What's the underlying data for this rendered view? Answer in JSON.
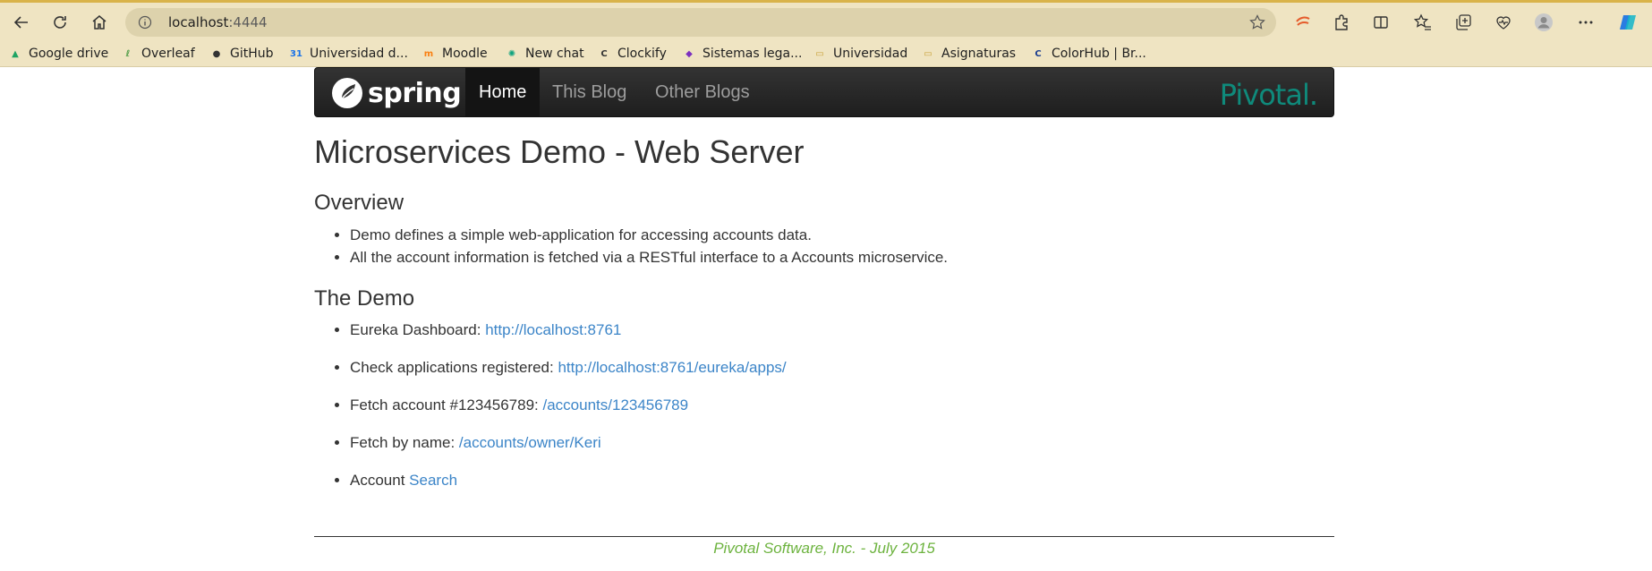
{
  "browser": {
    "url_host": "localhost",
    "url_port": ":4444",
    "icons": [
      "back-icon",
      "refresh-icon",
      "home-icon",
      "site-info-icon",
      "favorite-star-icon",
      "translate-icon",
      "extensions-icon",
      "split-screen-icon",
      "favorites-icon",
      "collections-icon",
      "performance-icon",
      "profile-icon",
      "more-icon",
      "copilot-icon"
    ],
    "bookmarks": [
      {
        "label": "Google drive",
        "icon": "google-drive-icon",
        "color": "#1fa463"
      },
      {
        "label": "Overleaf",
        "icon": "overleaf-icon",
        "color": "#4f9c45"
      },
      {
        "label": "GitHub",
        "icon": "github-icon",
        "color": "#333333"
      },
      {
        "label": "Universidad d...",
        "icon": "calendar-icon",
        "color": "#1a73e8"
      },
      {
        "label": "Moodle",
        "icon": "moodle-icon",
        "color": "#f98012"
      },
      {
        "label": "New chat",
        "icon": "chatgpt-icon",
        "color": "#10a37f"
      },
      {
        "label": "Clockify",
        "icon": "clockify-icon",
        "color": "#333333"
      },
      {
        "label": "Sistemas lega...",
        "icon": "bookmark-icon",
        "color": "#7b2fbf"
      },
      {
        "label": "Universidad",
        "icon": "folder-icon",
        "color": "#c9a23a"
      },
      {
        "label": "Asignaturas",
        "icon": "folder-icon",
        "color": "#c9a23a"
      },
      {
        "label": "ColorHub | Br...",
        "icon": "colorhub-icon",
        "color": "#1a3d8f"
      }
    ]
  },
  "navbar": {
    "brand": "spring",
    "items": [
      {
        "label": "Home",
        "active": true
      },
      {
        "label": "This Blog",
        "active": false
      },
      {
        "label": "Other Blogs",
        "active": false
      }
    ],
    "logo_right": "Pivotal."
  },
  "page": {
    "title": "Microservices Demo - Web Server",
    "overview": {
      "heading": "Overview",
      "items": [
        "Demo defines a simple web-application for accessing accounts data.",
        "All the account information is fetched via a RESTful interface to a Accounts microservice."
      ]
    },
    "demo": {
      "heading": "The Demo",
      "items": [
        {
          "text": "Eureka Dashboard: ",
          "link": "http://localhost:8761"
        },
        {
          "text": "Check applications registered: ",
          "link": "http://localhost:8761/eureka/apps/"
        },
        {
          "text": "Fetch account #123456789: ",
          "link": "/accounts/123456789"
        },
        {
          "text": "Fetch by name: ",
          "link": "/accounts/owner/Keri"
        },
        {
          "text": "Account ",
          "link": "Search"
        }
      ]
    },
    "footer": "Pivotal Software, Inc. - July 2015"
  },
  "colors": {
    "link": "#3c85c8",
    "footer": "#6db33f",
    "spring_green": "#6db33f",
    "pivotal_teal": "#0f8a7b",
    "browser_chrome": "#efe4c2"
  }
}
